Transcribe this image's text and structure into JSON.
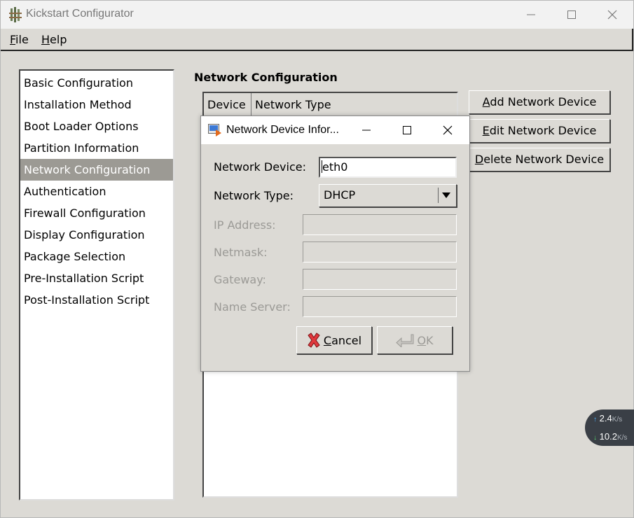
{
  "window": {
    "title": "Kickstart Configurator",
    "controls": [
      "minimize",
      "maximize",
      "close"
    ]
  },
  "menu": {
    "items": [
      {
        "accel": "F",
        "rest": "ile"
      },
      {
        "accel": "H",
        "rest": "elp"
      }
    ]
  },
  "nav": {
    "items": [
      "Basic Configuration",
      "Installation Method",
      "Boot Loader Options",
      "Partition Information",
      "Network Configuration",
      "Authentication",
      "Firewall Configuration",
      "Display Configuration",
      "Package Selection",
      "Pre-Installation Script",
      "Post-Installation Script"
    ],
    "selected": "Network Configuration"
  },
  "main": {
    "section_title": "Network Configuration",
    "table_headers": [
      "Device",
      "Network Type"
    ],
    "buttons": {
      "add": {
        "accel": "A",
        "rest": "dd Network Device"
      },
      "edit": {
        "accel": "E",
        "rest": "dit Network Device"
      },
      "delete": {
        "accel": "D",
        "rest": "elete Network Device"
      }
    }
  },
  "dialog": {
    "title": "Network Device Infor...",
    "device_label": "Network Device:",
    "device_value_first": "e",
    "device_value_rest": "th0",
    "type_label": "Network Type:",
    "type_value": "DHCP",
    "ip_label": "IP Address:",
    "netmask_label": "Netmask:",
    "gateway_label": "Gateway:",
    "nameserver_label": "Name Server:",
    "cancel": {
      "accel": "C",
      "rest": "ancel"
    },
    "ok": {
      "accel": "O",
      "rest": "K"
    }
  },
  "netspeed": {
    "up_value": "2.4",
    "down_value": "10.2",
    "unit": "K/s"
  },
  "colors": {
    "selection": "#9c9a94",
    "background": "#dcdad5",
    "cancel_icon": "#e0393e",
    "widget_bg": "#3a3f46",
    "up_arrow": "#4fb3ff",
    "down_arrow": "#54d16a"
  }
}
